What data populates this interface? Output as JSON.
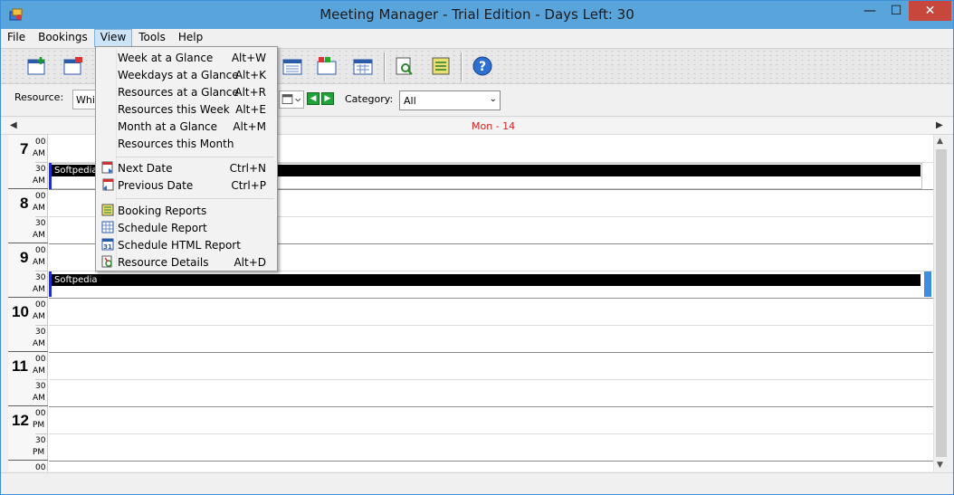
{
  "window": {
    "title": "Meeting Manager - Trial Edition - Days Left:  30",
    "minimize_glyph": "—",
    "maximize_glyph": "☐",
    "close_glyph": "✕"
  },
  "menubar": {
    "items": [
      {
        "label": "File"
      },
      {
        "label": "Bookings"
      },
      {
        "label": "View"
      },
      {
        "label": "Tools"
      },
      {
        "label": "Help"
      }
    ]
  },
  "view_menu": {
    "items": [
      {
        "label": "Week at a Glance",
        "shortcut": "Alt+W"
      },
      {
        "label": "Weekdays at a Glance",
        "shortcut": "Alt+K"
      },
      {
        "label": "Resources at a Glance",
        "shortcut": "Alt+R"
      },
      {
        "label": "Resources this Week",
        "shortcut": "Alt+E"
      },
      {
        "label": "Month at a Glance",
        "shortcut": "Alt+M"
      },
      {
        "label": "Resources this Month",
        "shortcut": ""
      },
      {
        "label": "Next Date",
        "shortcut": "Ctrl+N",
        "icon": "calendar-next-icon"
      },
      {
        "label": "Previous Date",
        "shortcut": "Ctrl+P",
        "icon": "calendar-previous-icon"
      },
      {
        "label": "Booking Reports",
        "shortcut": "",
        "icon": "report-icon"
      },
      {
        "label": "Schedule Report",
        "shortcut": "",
        "icon": "schedule-report-icon"
      },
      {
        "label": "Schedule HTML Report",
        "shortcut": "",
        "icon": "html-report-icon"
      },
      {
        "label": "Resource Details",
        "shortcut": "Alt+D",
        "icon": "resource-details-icon"
      }
    ]
  },
  "filterbar": {
    "resource_label": "Resource:",
    "resource_value": "Whit",
    "category_label": "Category:",
    "category_value": "All",
    "prev_glyph": "◀",
    "next_glyph": "▶",
    "combo_arrow": "⌄"
  },
  "dayheader": {
    "label": "Mon - 14",
    "left_arrow": "◀",
    "right_arrow": "▶"
  },
  "timeslots": [
    {
      "hour": "7",
      "ampm": "AM",
      "half": "30",
      "half_ampm": "AM"
    },
    {
      "hour": "8",
      "ampm": "AM",
      "half": "30",
      "half_ampm": "AM"
    },
    {
      "hour": "9",
      "ampm": "AM",
      "half": "30",
      "half_ampm": "AM"
    },
    {
      "hour": "10",
      "ampm": "AM",
      "half": "30",
      "half_ampm": "AM"
    },
    {
      "hour": "11",
      "ampm": "AM",
      "half": "30",
      "half_ampm": "AM"
    },
    {
      "hour": "12",
      "ampm": "PM",
      "half": "30",
      "half_ampm": "PM"
    }
  ],
  "minute_zero": "00",
  "bookings": [
    {
      "title": "Softpedia",
      "slot": "7:30 AM"
    },
    {
      "title": "Softpedia",
      "slot": "9:30 AM"
    }
  ],
  "colors": {
    "titlebar": "#5aa4dc",
    "close_button": "#c7473d",
    "day_label": "#d0201e",
    "booking_bg": "#000000",
    "booking_accent": "#1f2ec9"
  }
}
